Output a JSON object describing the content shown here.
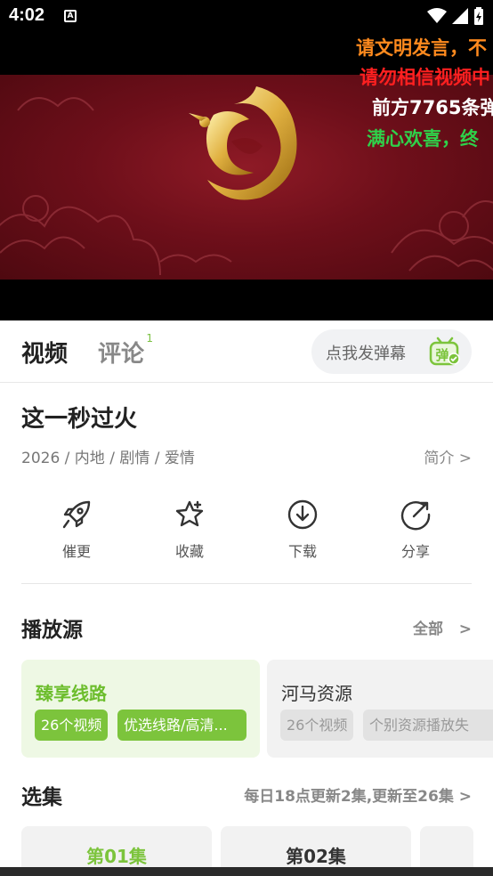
{
  "status_bar": {
    "time": "4:02",
    "notification_glyph": "A"
  },
  "player": {
    "danmaku": [
      {
        "text": "请文明发言，不",
        "color": "#ff8a1e"
      },
      {
        "text": "请勿相信视频中",
        "color": "#ff2020"
      },
      {
        "text": "前方7765条弹",
        "color": "#ffffff"
      },
      {
        "text": "满心欢喜，终",
        "color": "#2fd04a"
      }
    ]
  },
  "tabs": {
    "video": "视频",
    "comment": "评论",
    "comment_count": "1",
    "danmu_placeholder": "点我发弹幕",
    "danmu_icon_char": "弹"
  },
  "show": {
    "title": "这一秒过火",
    "meta": "2026 / 内地 / 剧情 / 爱情",
    "intro_label": "简介 >"
  },
  "actions": [
    {
      "label": "催更",
      "icon": "rocket-icon"
    },
    {
      "label": "收藏",
      "icon": "star-icon"
    },
    {
      "label": "下载",
      "icon": "download-icon"
    },
    {
      "label": "分享",
      "icon": "share-icon"
    }
  ],
  "sources": {
    "title": "播放源",
    "all_label": "全部",
    "items": [
      {
        "name": "臻享线路",
        "count": "26个视频",
        "note": "优选线路/高清...",
        "active": true
      },
      {
        "name": "河马资源",
        "count": "26个视频",
        "note": "个别资源播放失",
        "active": false
      }
    ]
  },
  "episodes": {
    "title": "选集",
    "update_info": "每日18点更新2集,更新至26集 >",
    "items": [
      "第01集",
      "第02集",
      ""
    ]
  },
  "colors": {
    "accent": "#7cc43c",
    "accent_light": "#eef8e4"
  }
}
